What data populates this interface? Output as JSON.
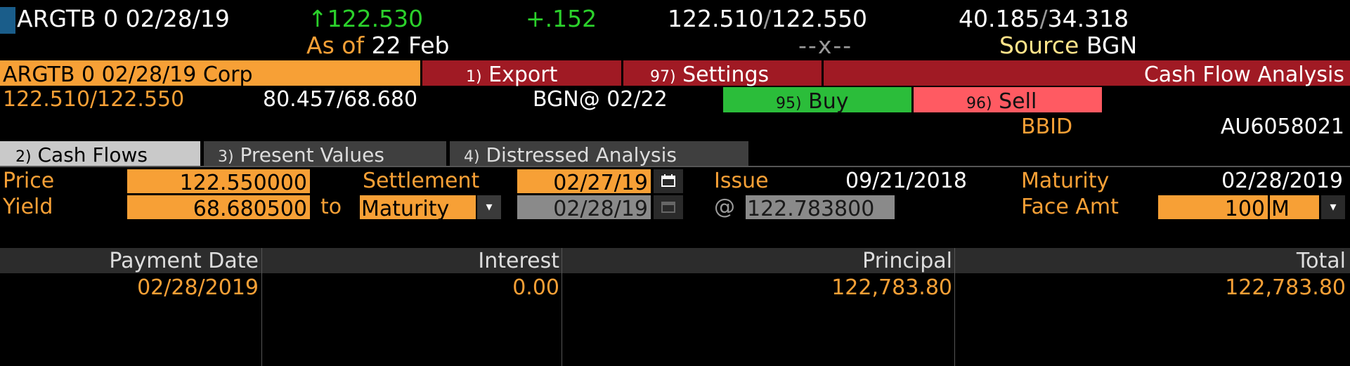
{
  "header": {
    "ticker": "ARGTB 0 02/28/19",
    "up_arrow": "↑",
    "last_price": "122.530",
    "change": "+.152",
    "bid": "122.510",
    "ask": "122.550",
    "yield_bid": "40.185",
    "yield_ask": "34.318",
    "as_of_label": "As of",
    "as_of_date": "22 Feb",
    "x_placeholder": "--x--",
    "source_label": "Source",
    "source_value": "BGN",
    "slash": "/"
  },
  "bar": {
    "security": "ARGTB 0 02/28/19 Corp",
    "export_num": "1)",
    "export_label": "Export",
    "settings_num": "97)",
    "settings_label": "Settings",
    "screen_title": "Cash Flow Analysis"
  },
  "quote": {
    "price_pair": "122.510/122.550",
    "yield_pair": "80.457/68.680",
    "source_at": "BGN@ 02/22",
    "buy_num": "95)",
    "buy_label": "Buy",
    "sell_num": "96)",
    "sell_label": "Sell",
    "bbid_label": "BBID",
    "bbid_value": "AU6058021"
  },
  "tabs": [
    {
      "num": "2)",
      "label": "Cash Flows"
    },
    {
      "num": "3)",
      "label": "Present Values"
    },
    {
      "num": "4)",
      "label": "Distressed Analysis"
    }
  ],
  "form": {
    "price_label": "Price",
    "price_value": "122.550000",
    "settlement_label": "Settlement",
    "settlement_value": "02/27/19",
    "issue_label": "Issue",
    "issue_value": "09/21/2018",
    "maturity_label": "Maturity",
    "maturity_value": "02/28/2019",
    "yield_label": "Yield",
    "yield_value": "68.680500",
    "to_label": "to",
    "yield_type": "Maturity",
    "workout_date": "02/28/19",
    "at_label": "@",
    "workout_price": "122.783800",
    "face_label": "Face Amt",
    "face_value": "100",
    "face_unit": "M"
  },
  "table": {
    "headers": [
      "Payment Date",
      "Interest",
      "Principal",
      "Total"
    ],
    "rows": [
      [
        "02/28/2019",
        "0.00",
        "122,783.80",
        "122,783.80"
      ]
    ]
  },
  "colors": {
    "accent_orange": "#f7a036",
    "header_red": "#a01a24",
    "buy_green": "#2bbd3a",
    "sell_red": "#ff5a62",
    "up_green": "#2bd12b"
  },
  "icons": [
    "calendar-icon",
    "chevron-down-icon",
    "up-arrow-icon"
  ]
}
